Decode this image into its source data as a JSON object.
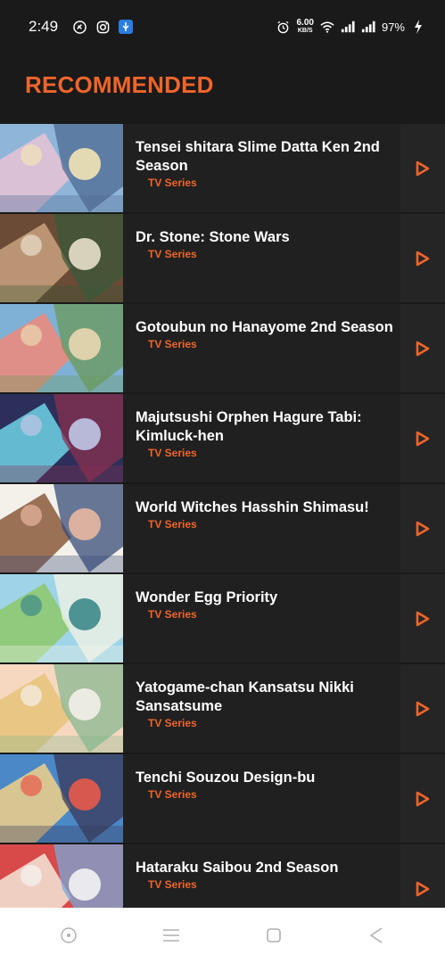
{
  "status": {
    "time": "2:49",
    "net_speed": "6.00",
    "net_unit": "KB/S",
    "battery": "97%"
  },
  "heading": "RECOMMENDED",
  "items": [
    {
      "title": "Tensei shitara Slime Datta Ken 2nd Season",
      "type": "TV Series",
      "colors": [
        "#8fb6d8",
        "#e9c3d6",
        "#4d6a93",
        "#f2e4b5"
      ]
    },
    {
      "title": "Dr. Stone: Stone Wars",
      "type": "TV Series",
      "colors": [
        "#6b4a36",
        "#c9a27e",
        "#3a5a3a",
        "#e8e0cc"
      ]
    },
    {
      "title": "Gotoubun no Hanayome 2nd Season",
      "type": "TV Series",
      "colors": [
        "#7fb0d6",
        "#f08a7a",
        "#6a9a5a",
        "#e9d7b0"
      ]
    },
    {
      "title": "Majutsushi Orphen Hagure Tabi: Kimluck-hen",
      "type": "TV Series",
      "colors": [
        "#2b2f5a",
        "#6fd2e6",
        "#8a3050",
        "#c0c8e8"
      ]
    },
    {
      "title": "World Witches Hasshin Shimasu!",
      "type": "TV Series",
      "colors": [
        "#f4f1ea",
        "#8b5a3c",
        "#3a4c7a",
        "#e8b8a0"
      ]
    },
    {
      "title": "Wonder Egg Priority",
      "type": "TV Series",
      "colors": [
        "#9fd4e8",
        "#8cc86a",
        "#f4f4e6",
        "#3e8a8a"
      ]
    },
    {
      "title": "Yatogame-chan Kansatsu Nikki Sansatsume",
      "type": "TV Series",
      "colors": [
        "#f6d8c0",
        "#e8c37a",
        "#88b890",
        "#f4f0ea"
      ]
    },
    {
      "title": "Tenchi Souzou Design-bu",
      "type": "TV Series",
      "colors": [
        "#4a88c8",
        "#f0d088",
        "#3a3a5a",
        "#e85a4a"
      ]
    },
    {
      "title": "Hataraku Saibou 2nd Season",
      "type": "TV Series",
      "colors": [
        "#d84a4a",
        "#f4e6d8",
        "#7aa8d8",
        "#f4f4f4"
      ]
    }
  ],
  "accent": "#f0652b"
}
